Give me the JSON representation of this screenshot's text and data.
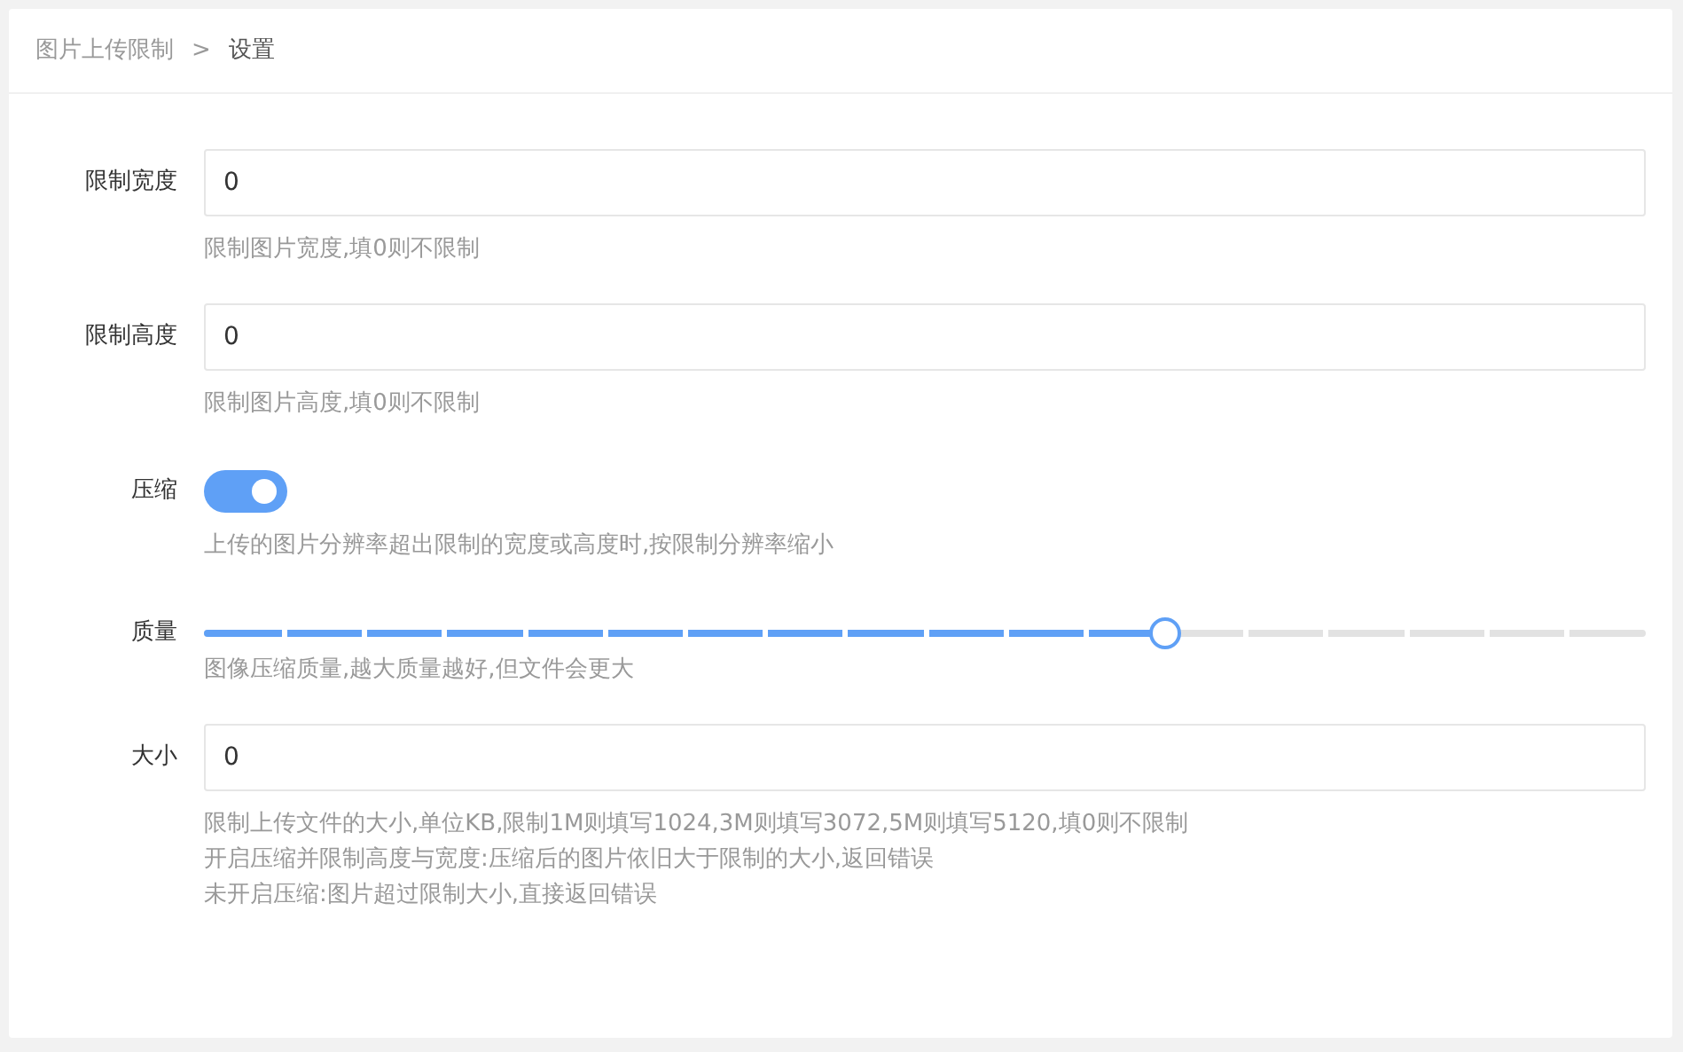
{
  "breadcrumb": [
    {
      "label": "图片上传限制",
      "current": false
    },
    {
      "label": "设置",
      "current": true
    }
  ],
  "breadcrumb_separator": ">",
  "fields": [
    {
      "kind": "text",
      "label": "限制宽度",
      "value": "0",
      "help": [
        "限制图片宽度,填0则不限制"
      ]
    },
    {
      "kind": "text",
      "label": "限制高度",
      "value": "0",
      "help": [
        "限制图片高度,填0则不限制"
      ]
    },
    {
      "kind": "switch",
      "label": "压缩",
      "on": true,
      "help": [
        "上传的图片分辨率超出限制的宽度或高度时,按限制分辨率缩小"
      ]
    },
    {
      "kind": "slider",
      "label": "质量",
      "level": 0.667,
      "help": [
        "图像压缩质量,越大质量越好,但文件会更大"
      ]
    },
    {
      "kind": "text",
      "label": "大小",
      "value": "0",
      "help": [
        "限制上传文件的大小,单位KB,限制1M则填写1024,3M则填写3072,5M则填写5120,填0则不限制",
        "开启压缩并限制高度与宽度:压缩后的图片依旧大于限制的大小,返回错误",
        "未开启压缩:图片超过限制大小,直接返回错误"
      ]
    }
  ]
}
